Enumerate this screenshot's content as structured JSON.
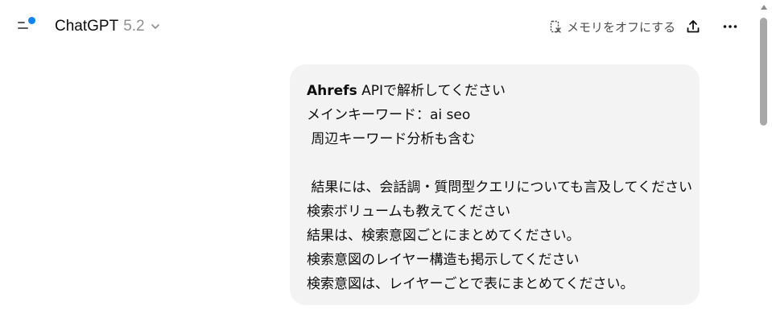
{
  "header": {
    "model_name": "ChatGPT",
    "model_version": "5.2",
    "memory_off_label": "メモリをオフにする",
    "icons": {
      "sidebar_toggle": "sidebar-toggle-icon",
      "chevron": "chevron-down-icon",
      "memory": "memory-off-icon",
      "share": "share-upload-icon",
      "more": "more-dots-icon"
    },
    "accent_color": "#0a84ff"
  },
  "message": {
    "first_line_bold": "Ahrefs",
    "first_line_rest": " APIで解析してください",
    "lines": [
      "メインキーワード：ai seo",
      " 周辺キーワード分析も含む",
      "",
      " 結果には、会話調・質問型クエリについても言及してください",
      "検索ボリュームも教えてください",
      "結果は、検索意図ごとにまとめてください。",
      "検索意図のレイヤー構造も掲示してください",
      "検索意図は、レイヤーごとで表にまとめてください。"
    ]
  }
}
